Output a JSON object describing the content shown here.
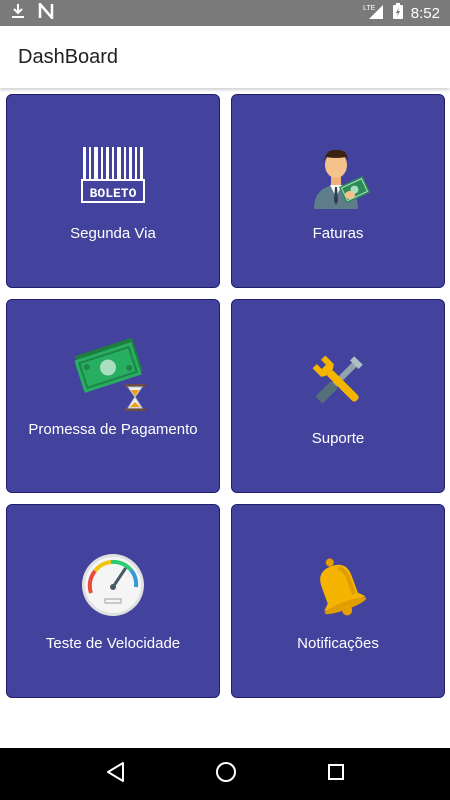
{
  "status_bar": {
    "time": "8:52",
    "network": "LTE",
    "icons": [
      "download-icon",
      "n-notification-icon",
      "signal-icon",
      "battery-icon"
    ]
  },
  "app_bar": {
    "title": "DashBoard"
  },
  "cards": [
    {
      "label": "Segunda Via",
      "icon": "boleto-barcode-icon",
      "barcode_text": "BOLETO"
    },
    {
      "label": "Faturas",
      "icon": "businessman-money-icon"
    },
    {
      "label": "Promessa de Pagamento",
      "icon": "money-hourglass-icon"
    },
    {
      "label": "Suporte",
      "icon": "tools-icon"
    },
    {
      "label": "Teste de Velocidade",
      "icon": "speedometer-icon"
    },
    {
      "label": "Notificações",
      "icon": "bell-icon"
    }
  ],
  "nav": [
    "back-icon",
    "home-icon",
    "recents-icon"
  ],
  "colors": {
    "card": "#43439e",
    "card_border": "#1f1f6e",
    "status_bar": "#7a7a7a",
    "nav_bar": "#000000"
  }
}
